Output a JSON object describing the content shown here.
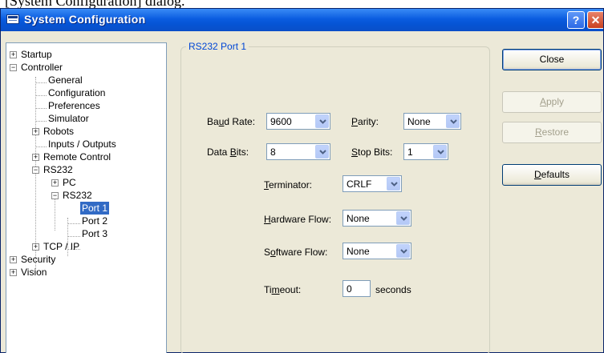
{
  "caption_fragment": "[System Configuration] dialog.",
  "window": {
    "title": "System Configuration",
    "help_glyph": "?",
    "close_glyph": "✕"
  },
  "tree": {
    "items": [
      {
        "label": "Startup",
        "expander": "+"
      },
      {
        "label": "Controller",
        "expander": "−"
      },
      {
        "label": "General"
      },
      {
        "label": "Configuration"
      },
      {
        "label": "Preferences"
      },
      {
        "label": "Simulator"
      },
      {
        "label": "Robots",
        "expander": "+"
      },
      {
        "label": "Inputs / Outputs"
      },
      {
        "label": "Remote Control",
        "expander": "+"
      },
      {
        "label": "RS232",
        "expander": "−"
      },
      {
        "label": "PC",
        "expander": "+"
      },
      {
        "label": "RS232",
        "expander": "−"
      },
      {
        "label": "Port 1",
        "selected": true
      },
      {
        "label": "Port 2"
      },
      {
        "label": "Port 3"
      },
      {
        "label": "TCP / IP",
        "expander": "+"
      },
      {
        "label": "Security",
        "expander": "+"
      },
      {
        "label": "Vision",
        "expander": "+"
      }
    ]
  },
  "group": {
    "title": "RS232 Port 1"
  },
  "fields": {
    "baud_rate": {
      "label_pre": "Ba",
      "label_key": "u",
      "label_post": "d Rate:",
      "value": "9600"
    },
    "parity": {
      "label_pre": "",
      "label_key": "P",
      "label_post": "arity:",
      "value": "None"
    },
    "data_bits": {
      "label_pre": "Data ",
      "label_key": "B",
      "label_post": "its:",
      "value": "8"
    },
    "stop_bits": {
      "label_pre": "",
      "label_key": "S",
      "label_post": "top Bits:",
      "value": "1"
    },
    "terminator": {
      "label_pre": "",
      "label_key": "T",
      "label_post": "erminator:",
      "value": "CRLF"
    },
    "hardware_flow": {
      "label_pre": "",
      "label_key": "H",
      "label_post": "ardware Flow:",
      "value": "None"
    },
    "software_flow": {
      "label_pre": "S",
      "label_key": "o",
      "label_post": "ftware Flow:",
      "value": "None"
    },
    "timeout": {
      "label_pre": "Ti",
      "label_key": "m",
      "label_post": "eout:",
      "value": "0",
      "unit": "seconds"
    }
  },
  "buttons": {
    "close": {
      "label": "Close"
    },
    "apply": {
      "label_key": "A",
      "label_post": "pply"
    },
    "restore": {
      "label_key": "R",
      "label_post": "estore"
    },
    "defaults": {
      "label_key": "D",
      "label_post": "efaults"
    }
  },
  "icons": {
    "window": "app-window-icon",
    "help": "help-icon",
    "close": "close-icon",
    "dropdown": "chevron-down-icon",
    "expand": "plus-box-icon",
    "collapse": "minus-box-icon"
  }
}
